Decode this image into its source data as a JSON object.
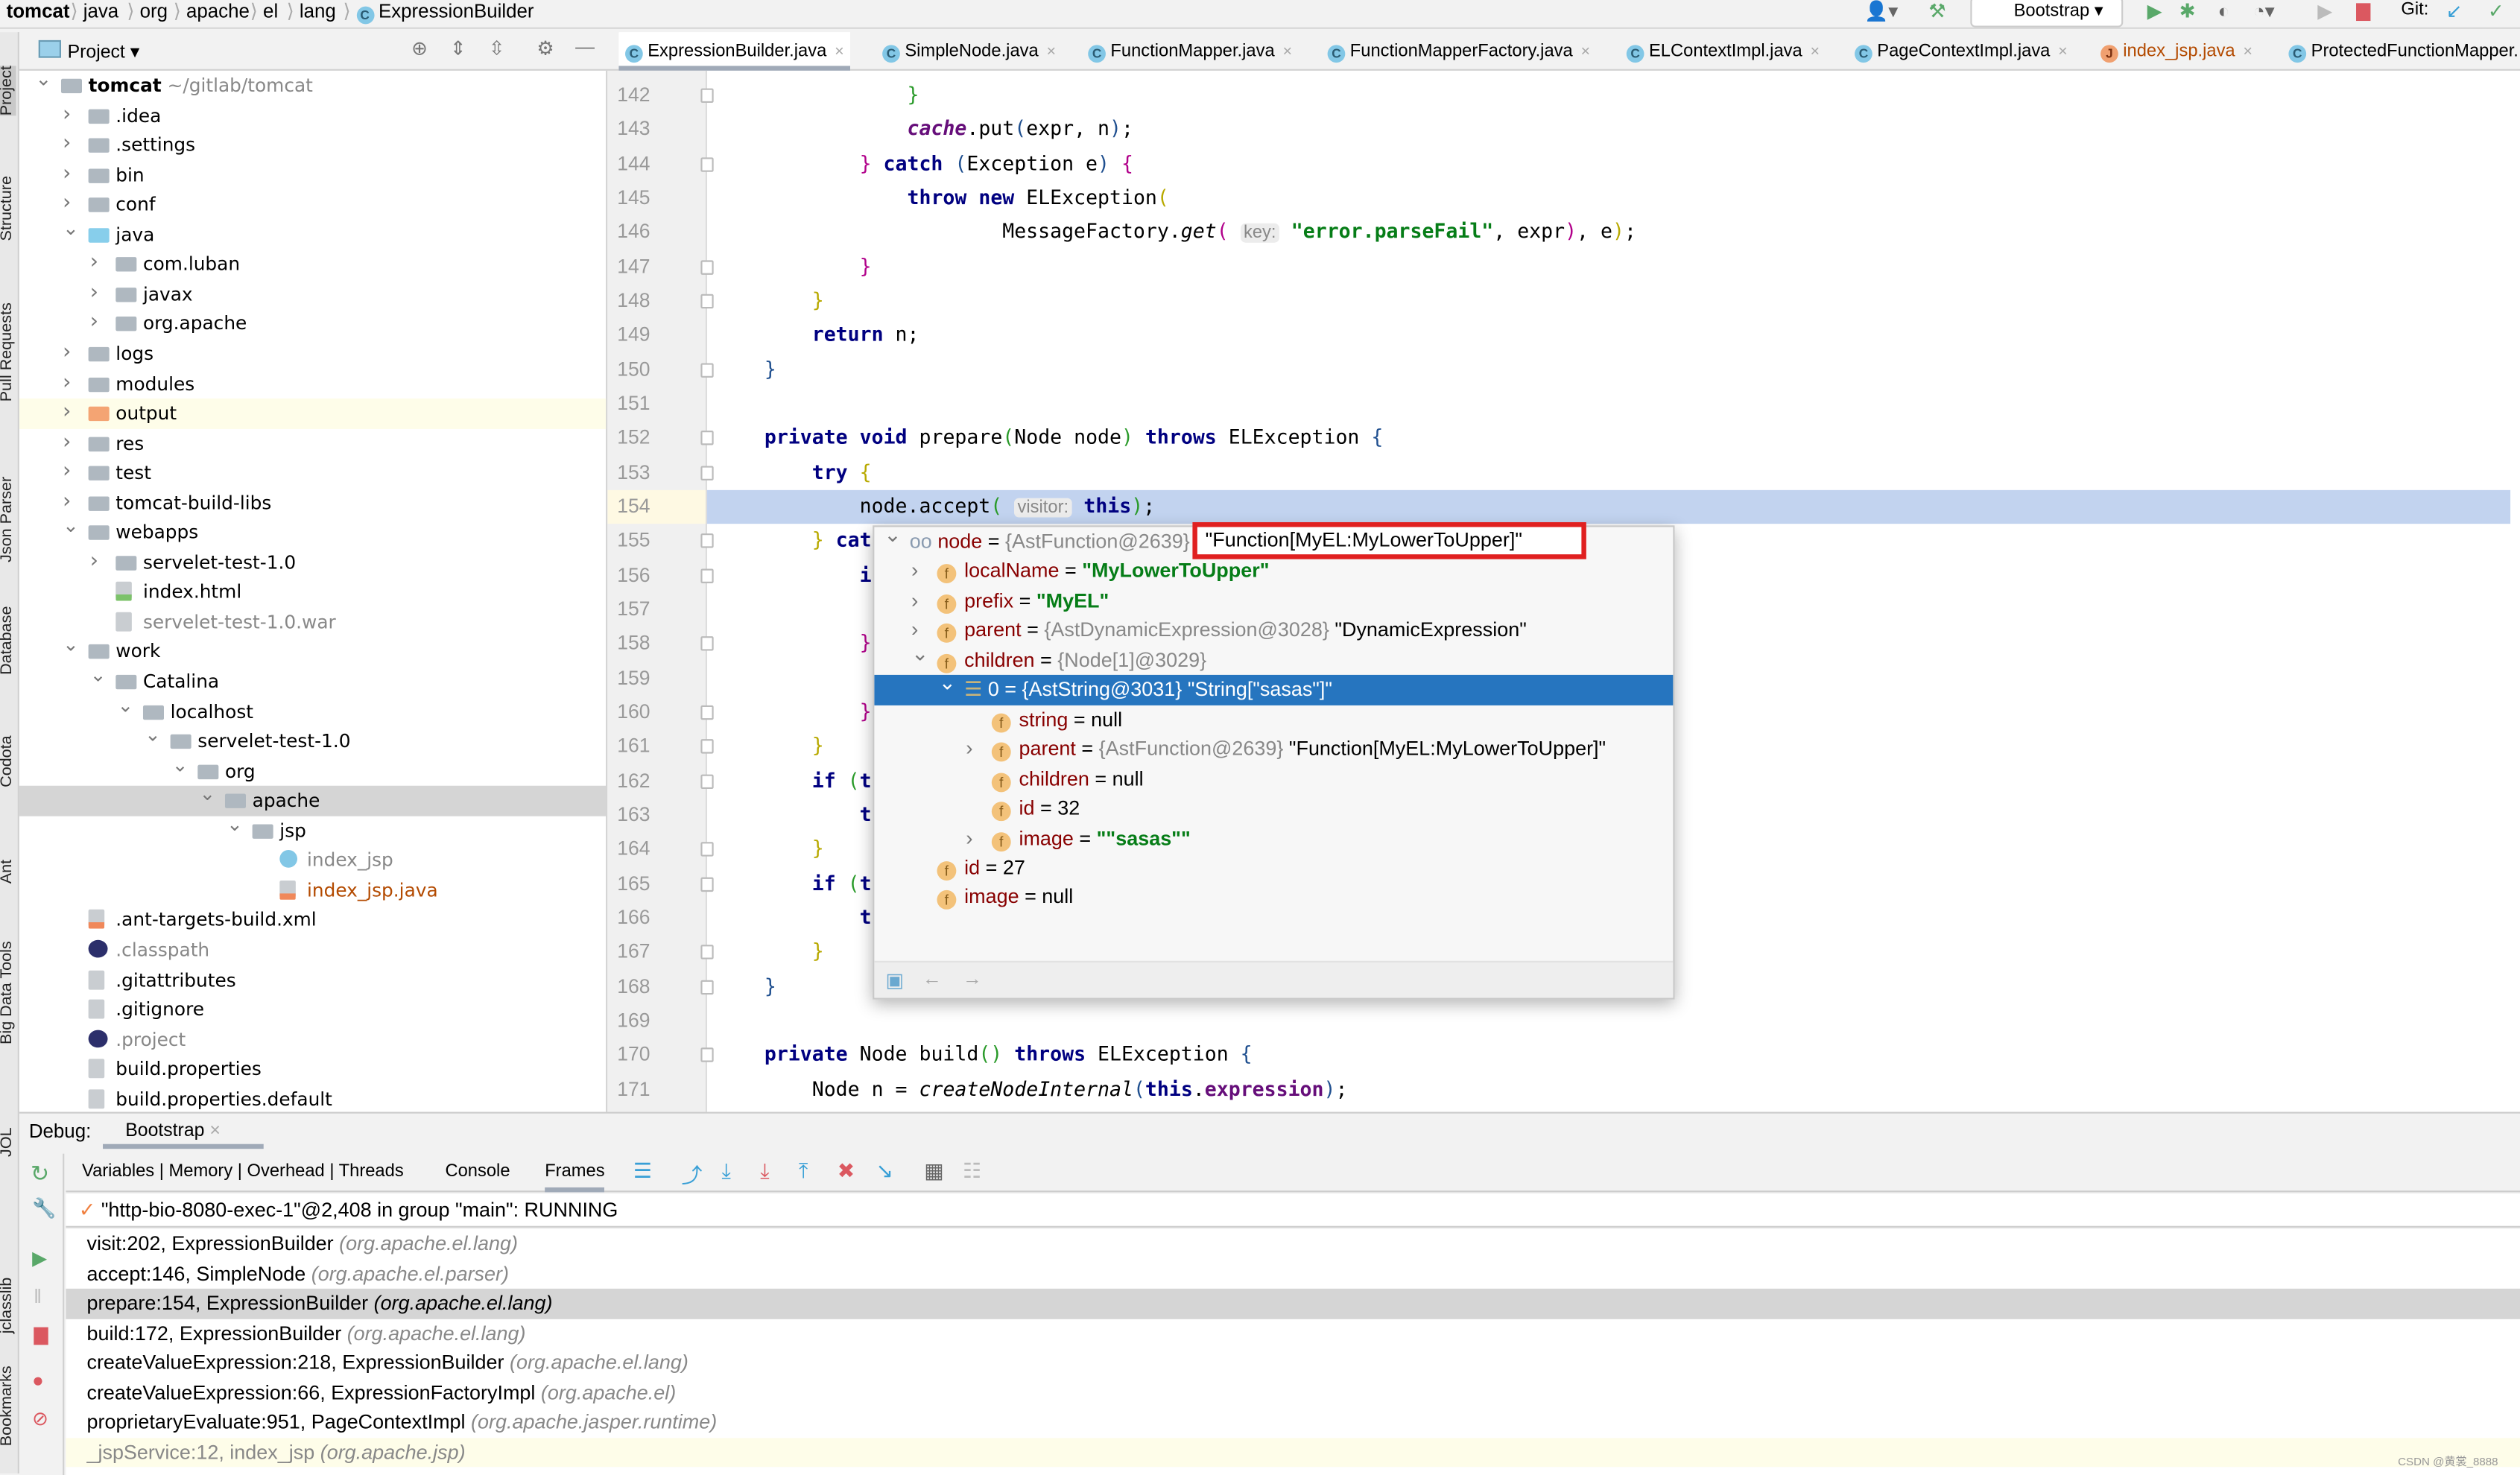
{
  "breadcrumb": [
    "tomcat",
    "java",
    "org",
    "apache",
    "el",
    "lang",
    "ExpressionBuilder"
  ],
  "toolbar": {
    "run_config": "Bootstrap",
    "git_label": "Git:",
    "colors": {
      "run": "#59a869",
      "stop": "#db5860",
      "git_update": "#389fd6"
    }
  },
  "left_tools": [
    "Project",
    "Structure",
    "Pull Requests",
    "Json Parser",
    "Database",
    "Codota",
    "Ant",
    "Big Data Tools",
    "JOL"
  ],
  "left_tools_bottom": [
    "jclasslib",
    "Bookmarks"
  ],
  "project_panel": {
    "title": "Project",
    "tree": [
      {
        "label": "tomcat",
        "suffix": "~/gitlab/tomcat",
        "level": 0,
        "state": "open",
        "icon": "module-folder-icon",
        "bold": true
      },
      {
        "label": ".idea",
        "level": 1,
        "state": "closed",
        "icon": "folder-icon"
      },
      {
        "label": ".settings",
        "level": 1,
        "state": "closed",
        "icon": "folder-icon"
      },
      {
        "label": "bin",
        "level": 1,
        "state": "closed",
        "icon": "folder-icon"
      },
      {
        "label": "conf",
        "level": 1,
        "state": "closed",
        "icon": "folder-icon"
      },
      {
        "label": "java",
        "level": 1,
        "state": "open",
        "icon": "source-folder-icon"
      },
      {
        "label": "com.luban",
        "level": 2,
        "state": "closed",
        "icon": "package-icon"
      },
      {
        "label": "javax",
        "level": 2,
        "state": "closed",
        "icon": "package-icon"
      },
      {
        "label": "org.apache",
        "level": 2,
        "state": "closed",
        "icon": "package-icon"
      },
      {
        "label": "logs",
        "level": 1,
        "state": "closed",
        "icon": "folder-icon"
      },
      {
        "label": "modules",
        "level": 1,
        "state": "closed",
        "icon": "folder-icon"
      },
      {
        "label": "output",
        "level": 1,
        "state": "closed",
        "icon": "excluded-folder-icon",
        "highlight": true
      },
      {
        "label": "res",
        "level": 1,
        "state": "closed",
        "icon": "folder-icon"
      },
      {
        "label": "test",
        "level": 1,
        "state": "closed",
        "icon": "folder-icon"
      },
      {
        "label": "tomcat-build-libs",
        "level": 1,
        "state": "closed",
        "icon": "folder-icon"
      },
      {
        "label": "webapps",
        "level": 1,
        "state": "open",
        "icon": "folder-icon"
      },
      {
        "label": "servelet-test-1.0",
        "level": 2,
        "state": "closed",
        "icon": "folder-icon"
      },
      {
        "label": "index.html",
        "level": 2,
        "state": "leaf",
        "icon": "html-file-icon"
      },
      {
        "label": "servelet-test-1.0.war",
        "level": 2,
        "state": "leaf",
        "icon": "archive-icon",
        "dim": true
      },
      {
        "label": "work",
        "level": 1,
        "state": "open",
        "icon": "folder-icon"
      },
      {
        "label": "Catalina",
        "level": 2,
        "state": "open",
        "icon": "folder-icon"
      },
      {
        "label": "localhost",
        "level": 3,
        "state": "open",
        "icon": "folder-icon"
      },
      {
        "label": "servelet-test-1.0",
        "level": 4,
        "state": "open",
        "icon": "folder-icon"
      },
      {
        "label": "org",
        "level": 5,
        "state": "open",
        "icon": "folder-icon"
      },
      {
        "label": "apache",
        "level": 6,
        "state": "open",
        "icon": "folder-icon",
        "selected": true
      },
      {
        "label": "jsp",
        "level": 7,
        "state": "open",
        "icon": "folder-icon"
      },
      {
        "label": "index_jsp",
        "level": 8,
        "state": "leaf",
        "icon": "class-icon",
        "dim": true
      },
      {
        "label": "index_jsp.java",
        "level": 8,
        "state": "leaf",
        "icon": "java-file-icon",
        "orange": true
      },
      {
        "label": ".ant-targets-build.xml",
        "level": 1,
        "state": "leaf",
        "icon": "xml-file-icon"
      },
      {
        "label": ".classpath",
        "level": 1,
        "state": "leaf",
        "icon": "eclipse-icon",
        "dim": true
      },
      {
        "label": ".gitattributes",
        "level": 1,
        "state": "leaf",
        "icon": "text-file-icon"
      },
      {
        "label": ".gitignore",
        "level": 1,
        "state": "leaf",
        "icon": "ignore-file-icon"
      },
      {
        "label": ".project",
        "level": 1,
        "state": "leaf",
        "icon": "eclipse-icon",
        "dim": true
      },
      {
        "label": "build.properties",
        "level": 1,
        "state": "leaf",
        "icon": "properties-file-icon"
      },
      {
        "label": "build.properties.default",
        "level": 1,
        "state": "leaf",
        "icon": "text-file-icon"
      }
    ]
  },
  "tabs": [
    {
      "label": "ExpressionBuilder.java",
      "active": true
    },
    {
      "label": "SimpleNode.java"
    },
    {
      "label": "FunctionMapper.java"
    },
    {
      "label": "FunctionMapperFactory.java"
    },
    {
      "label": "ELContextImpl.java"
    },
    {
      "label": "PageContextImpl.java"
    },
    {
      "label": "index_jsp.java",
      "orange": true
    },
    {
      "label": "ProtectedFunctionMapper..."
    }
  ],
  "editor": {
    "current_line": 154,
    "lines": [
      {
        "n": 142,
        "i": 16,
        "t": [
          [
            "}",
            "br4"
          ]
        ]
      },
      {
        "n": 143,
        "i": 16,
        "t": [
          [
            "cache",
            "fi"
          ],
          [
            ".put",
            ""
          ],
          [
            "(",
            "br3"
          ],
          [
            "expr, ",
            ""
          ],
          [
            "n",
            ""
          ],
          [
            ")",
            "br3"
          ],
          [
            ";",
            ""
          ]
        ]
      },
      {
        "n": 144,
        "i": 12,
        "t": [
          [
            "}",
            "br2"
          ],
          [
            " ",
            ""
          ],
          [
            "catch",
            "kw"
          ],
          [
            " ",
            ""
          ],
          [
            "(",
            "br3"
          ],
          [
            "Exception e",
            ""
          ],
          [
            ")",
            "br3"
          ],
          [
            " ",
            ""
          ],
          [
            "{",
            "br2"
          ]
        ]
      },
      {
        "n": 145,
        "i": 16,
        "t": [
          [
            "throw",
            "kw"
          ],
          [
            " ",
            ""
          ],
          [
            "new",
            "kw"
          ],
          [
            " ELException",
            ""
          ],
          [
            "(",
            "br1"
          ]
        ]
      },
      {
        "n": 146,
        "i": 24,
        "t": [
          [
            "MessageFactory.",
            ""
          ],
          [
            "get",
            "ital"
          ],
          [
            "(",
            "br2"
          ],
          [
            " ",
            ""
          ],
          [
            "key:",
            "hint"
          ],
          [
            " ",
            ""
          ],
          [
            "\"error.parseFail\"",
            "str"
          ],
          [
            ", expr",
            ""
          ],
          [
            ")",
            "br2"
          ],
          [
            ", e",
            ""
          ],
          [
            ")",
            "br1"
          ],
          [
            ";",
            ""
          ]
        ]
      },
      {
        "n": 147,
        "i": 12,
        "t": [
          [
            "}",
            "br2"
          ]
        ]
      },
      {
        "n": 148,
        "i": 8,
        "t": [
          [
            "}",
            "br1"
          ]
        ]
      },
      {
        "n": 149,
        "i": 8,
        "t": [
          [
            "return",
            "kw"
          ],
          [
            " n;",
            ""
          ]
        ]
      },
      {
        "n": 150,
        "i": 4,
        "t": [
          [
            "}",
            "br3"
          ]
        ]
      },
      {
        "n": 151,
        "i": 0,
        "t": []
      },
      {
        "n": 152,
        "i": 4,
        "t": [
          [
            "private",
            "kw"
          ],
          [
            " ",
            ""
          ],
          [
            "void",
            "kw"
          ],
          [
            " prepare",
            ""
          ],
          [
            "(",
            "br4"
          ],
          [
            "Node node",
            ""
          ],
          [
            ")",
            "br4"
          ],
          [
            " ",
            ""
          ],
          [
            "throws",
            "kw"
          ],
          [
            " ELException ",
            ""
          ],
          [
            "{",
            "br3"
          ]
        ]
      },
      {
        "n": 153,
        "i": 8,
        "t": [
          [
            "try",
            "kw"
          ],
          [
            " ",
            ""
          ],
          [
            "{",
            "br1"
          ]
        ]
      },
      {
        "n": 154,
        "i": 12,
        "t": [
          [
            "node.accept",
            ""
          ],
          [
            "(",
            "br4"
          ],
          [
            " ",
            ""
          ],
          [
            "visitor:",
            "hint"
          ],
          [
            " ",
            ""
          ],
          [
            "this",
            "kw"
          ],
          [
            ")",
            "br4"
          ],
          [
            ";",
            ""
          ]
        ]
      },
      {
        "n": 155,
        "i": 8,
        "t": [
          [
            "}",
            "br1"
          ],
          [
            " ",
            ""
          ],
          [
            "cat",
            "kw"
          ]
        ]
      },
      {
        "n": 156,
        "i": 12,
        "t": [
          [
            "i",
            "kw"
          ]
        ]
      },
      {
        "n": 157,
        "i": 0,
        "t": []
      },
      {
        "n": 158,
        "i": 12,
        "t": [
          [
            "}",
            "br2"
          ]
        ]
      },
      {
        "n": 159,
        "i": 0,
        "t": []
      },
      {
        "n": 160,
        "i": 12,
        "t": [
          [
            "}",
            "br2"
          ]
        ]
      },
      {
        "n": 161,
        "i": 8,
        "t": [
          [
            "}",
            "br1"
          ]
        ]
      },
      {
        "n": 162,
        "i": 8,
        "t": [
          [
            "if",
            "kw"
          ],
          [
            " ",
            ""
          ],
          [
            "(",
            "br4"
          ],
          [
            "t",
            "kw"
          ]
        ]
      },
      {
        "n": 163,
        "i": 12,
        "t": [
          [
            "t",
            "kw"
          ]
        ]
      },
      {
        "n": 164,
        "i": 8,
        "t": [
          [
            "}",
            "br1"
          ]
        ]
      },
      {
        "n": 165,
        "i": 8,
        "t": [
          [
            "if",
            "kw"
          ],
          [
            " ",
            ""
          ],
          [
            "(",
            "br4"
          ],
          [
            "t",
            "kw"
          ]
        ]
      },
      {
        "n": 166,
        "i": 12,
        "t": [
          [
            "t",
            "kw"
          ]
        ]
      },
      {
        "n": 167,
        "i": 8,
        "t": [
          [
            "}",
            "br1"
          ]
        ]
      },
      {
        "n": 168,
        "i": 4,
        "t": [
          [
            "}",
            "br3"
          ]
        ]
      },
      {
        "n": 169,
        "i": 0,
        "t": []
      },
      {
        "n": 170,
        "i": 4,
        "t": [
          [
            "private",
            "kw"
          ],
          [
            " Node build",
            ""
          ],
          [
            "()",
            "br4"
          ],
          [
            " ",
            ""
          ],
          [
            "throws",
            "kw"
          ],
          [
            " ELException ",
            ""
          ],
          [
            "{",
            "br3"
          ]
        ]
      },
      {
        "n": 171,
        "i": 8,
        "t": [
          [
            "Node ",
            ""
          ],
          [
            "n",
            ""
          ],
          [
            " = ",
            ""
          ],
          [
            "createNodeInternal",
            "ital"
          ],
          [
            "(",
            "br3"
          ],
          [
            "this",
            "kw"
          ],
          [
            ".",
            ""
          ],
          [
            "expression",
            "fld"
          ],
          [
            ")",
            "br3"
          ],
          [
            ";",
            ""
          ]
        ]
      }
    ]
  },
  "popup": {
    "rows": [
      {
        "level": 0,
        "toggle": "open",
        "icon": "watch-icon",
        "name": "node",
        "ref": "{AstFunction@2639}",
        "value": "\"Function[MyEL:MyLowerToUpper]\"",
        "boxed": true
      },
      {
        "level": 1,
        "toggle": "closed",
        "icon": "field-icon",
        "name": "localName",
        "str": "\"MyLowerToUpper\""
      },
      {
        "level": 1,
        "toggle": "closed",
        "icon": "field-icon",
        "name": "prefix",
        "str": "\"MyEL\""
      },
      {
        "level": 1,
        "toggle": "closed",
        "icon": "field-icon",
        "name": "parent",
        "ref": "{AstDynamicExpression@3028}",
        "value": "\"DynamicExpression\""
      },
      {
        "level": 1,
        "toggle": "open",
        "icon": "field-icon",
        "name": "children",
        "ref": "{Node[1]@3029}"
      },
      {
        "level": 2,
        "toggle": "open",
        "icon": "array-element-icon",
        "name": "0",
        "ref": "{AstString@3031}",
        "value": "\"String[\"sasas\"]\"",
        "selected": true
      },
      {
        "level": 3,
        "toggle": "none",
        "icon": "field-icon",
        "name": "string",
        "value": "null"
      },
      {
        "level": 3,
        "toggle": "closed",
        "icon": "field-icon",
        "name": "parent",
        "ref": "{AstFunction@2639}",
        "value": "\"Function[MyEL:MyLowerToUpper]\""
      },
      {
        "level": 3,
        "toggle": "none",
        "icon": "field-icon",
        "name": "children",
        "value": "null"
      },
      {
        "level": 3,
        "toggle": "none",
        "icon": "field-icon",
        "name": "id",
        "value": "32"
      },
      {
        "level": 3,
        "toggle": "closed",
        "icon": "field-icon",
        "name": "image",
        "str": "\"\"sasas\"\""
      },
      {
        "level": 1,
        "toggle": "none",
        "icon": "field-icon",
        "name": "id",
        "value": "27"
      },
      {
        "level": 1,
        "toggle": "none",
        "icon": "field-icon",
        "name": "image",
        "value": "null"
      }
    ]
  },
  "debug": {
    "label": "Debug:",
    "session": "Bootstrap",
    "tabs": [
      "Variables | Memory | Overhead | Threads",
      "Console",
      "Frames"
    ],
    "active_tab": "Frames",
    "thread": "\"http-bio-8080-exec-1\"@2,408 in group \"main\": RUNNING",
    "frames": [
      {
        "method": "visit:202, ExpressionBuilder",
        "pkg": "(org.apache.el.lang)"
      },
      {
        "method": "accept:146, SimpleNode",
        "pkg": "(org.apache.el.parser)"
      },
      {
        "method": "prepare:154, ExpressionBuilder",
        "pkg": "(org.apache.el.lang)",
        "selected": true
      },
      {
        "method": "build:172, ExpressionBuilder",
        "pkg": "(org.apache.el.lang)"
      },
      {
        "method": "createValueExpression:218, ExpressionBuilder",
        "pkg": "(org.apache.el.lang)"
      },
      {
        "method": "createValueExpression:66, ExpressionFactoryImpl",
        "pkg": "(org.apache.el)"
      },
      {
        "method": "proprietaryEvaluate:951, PageContextImpl",
        "pkg": "(org.apache.jasper.runtime)"
      },
      {
        "method": "_jspService:12, index_jsp",
        "pkg": "(org.apache.jsp)",
        "library": true
      }
    ]
  },
  "watermark": "CSDN @黄裳_8888"
}
